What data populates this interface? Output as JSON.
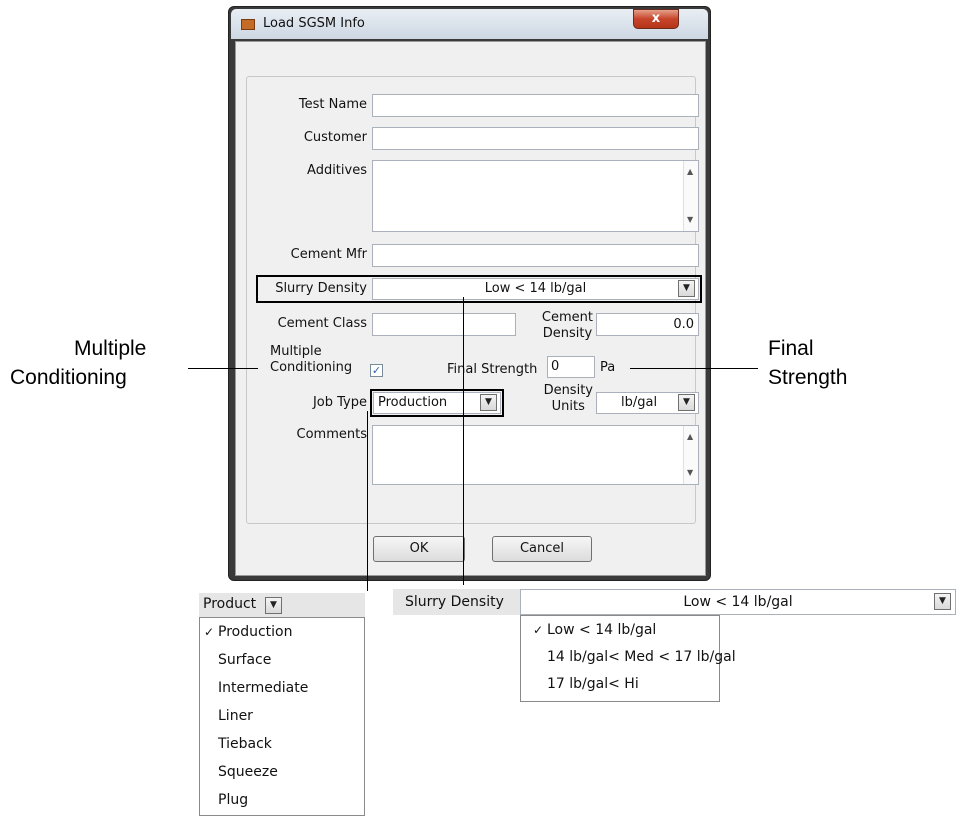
{
  "dialog": {
    "title": "Load SGSM Info",
    "close_glyph": "x",
    "fields": {
      "test_name_label": "Test Name",
      "test_name_value": "",
      "customer_label": "Customer",
      "customer_value": "",
      "additives_label": "Additives",
      "additives_value": "",
      "cement_mfr_label": "Cement Mfr",
      "cement_mfr_value": "",
      "slurry_density_label": "Slurry Density",
      "slurry_density_value": "Low < 14 lb/gal",
      "cement_class_label": "Cement Class",
      "cement_class_value": "",
      "cement_density_label_1": "Cement",
      "cement_density_label_2": "Density",
      "cement_density_value": "0.0",
      "multiple_conditioning_label_1": "Multiple",
      "multiple_conditioning_label_2": "Conditioning",
      "multiple_conditioning_checked": true,
      "final_strength_label": "Final Strength",
      "final_strength_value": "0",
      "final_strength_unit": "Pa",
      "job_type_label": "Job Type",
      "job_type_value": "Production",
      "density_units_label_1": "Density",
      "density_units_label_2": "Units",
      "density_units_value": "lb/gal",
      "comments_label": "Comments",
      "comments_value": ""
    },
    "ok_label": "OK",
    "cancel_label": "Cancel"
  },
  "callouts": {
    "left_1": "Multiple",
    "left_2": "Conditioning",
    "right_1": "Final",
    "right_2": "Strength"
  },
  "job_type_dropdown": {
    "header_label": "Product",
    "options": [
      "Production",
      "Surface",
      "Intermediate",
      "Liner",
      "Tieback",
      "Squeeze",
      "Plug"
    ],
    "selected": "Production",
    "check_glyph": "✓"
  },
  "slurry_density_dropdown": {
    "header_label": "Slurry Density",
    "value": "Low < 14 lb/gal",
    "options": [
      "Low < 14 lb/gal",
      "14 lb/gal< Med < 17 lb/gal",
      "17 lb/gal< Hi"
    ],
    "selected": "Low < 14 lb/gal",
    "check_glyph": "✓"
  },
  "icons": {
    "scroll_up": "▲",
    "scroll_down": "▼",
    "combo_arrow": "▼",
    "checkbox_mark": "✓"
  }
}
